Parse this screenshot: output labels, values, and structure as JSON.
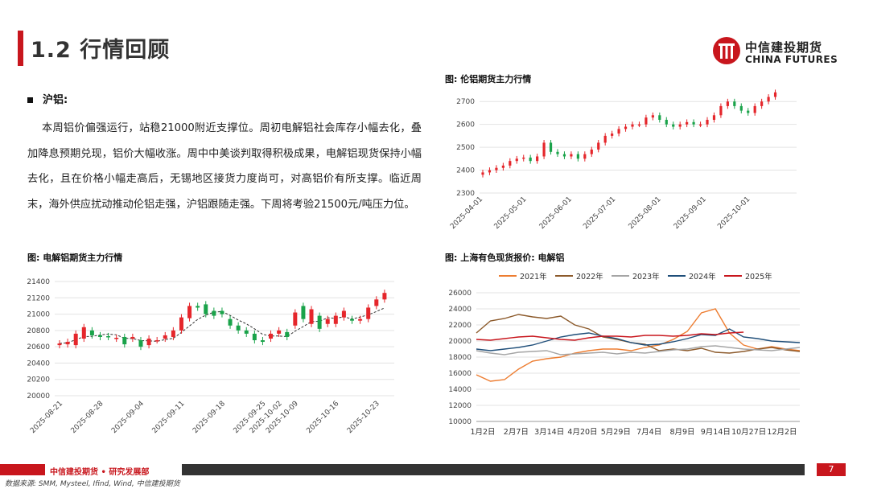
{
  "header": {
    "title": "1.2 行情回顾",
    "logo_cn": "中信建投期货",
    "logo_en": "CHINA FUTURES"
  },
  "section": {
    "heading": "沪铝:",
    "body": "本周铝价偏强运行，站稳21000附近支撑位。周初电解铝社会库存小幅去化，叠加降息预期兑现，铝价大幅收涨。周中中美谈判取得积极成果，电解铝现货保持小幅去化，且在价格小幅走高后，无锡地区接货力度尚可，对高铝价有所支撑。临近周末，海外供应扰动推动伦铝走强，沪铝跟随走强。下周将考验21500元/吨压力位。"
  },
  "footer": {
    "brand": "中信建投期货 • 研究发展部",
    "page": "7",
    "source": "数据来源: SMM, Mysteel, Ifind, Wind, 中信建投期货"
  },
  "colors": {
    "accent_red": "#c8161d",
    "candle_up": "#e5262b",
    "candle_down": "#1aa34a"
  },
  "chart_data": [
    {
      "type": "candlestick",
      "title": "图: 伦铝期货主力行情",
      "ylim": [
        2300,
        2750
      ],
      "y_ticks": [
        2300,
        2400,
        2500,
        2600,
        2700
      ],
      "x_ticks": [
        "2025-04-01",
        "2025-05-01",
        "2025-06-01",
        "2025-07-01",
        "2025-08-01",
        "2025-09-01",
        "2025-10-01"
      ],
      "x_range": [
        "2025-04-01",
        "2025-10-24"
      ],
      "grid": true,
      "close": [
        2390,
        2400,
        2410,
        2420,
        2440,
        2450,
        2455,
        2440,
        2460,
        2520,
        2480,
        2470,
        2460,
        2470,
        2450,
        2470,
        2490,
        2520,
        2550,
        2560,
        2580,
        2590,
        2600,
        2600,
        2630,
        2640,
        2620,
        2600,
        2590,
        2600,
        2610,
        2600,
        2600,
        2620,
        2640,
        2680,
        2700,
        2680,
        2660,
        2650,
        2680,
        2700,
        2720,
        2740
      ]
    },
    {
      "type": "candlestick",
      "title": "图: 电解铝期货主力行情",
      "ylim": [
        20000,
        21400
      ],
      "y_ticks": [
        20000,
        20200,
        20400,
        20600,
        20800,
        21000,
        21200,
        21400
      ],
      "x_ticks": [
        "2025-08-21",
        "2025-08-28",
        "2025-09-04",
        "2025-09-11",
        "2025-09-18",
        "2025-09-25",
        "2025-10-02",
        "2025-10-09",
        "2025-10-16",
        "2025-10-23"
      ],
      "ma_line": true,
      "grid": true,
      "candles": [
        {
          "date": "2025-08-21",
          "o": 20620,
          "c": 20640
        },
        {
          "date": "2025-08-22",
          "o": 20630,
          "c": 20660
        },
        {
          "date": "2025-08-25",
          "o": 20620,
          "c": 20760
        },
        {
          "date": "2025-08-26",
          "o": 20700,
          "c": 20840
        },
        {
          "date": "2025-08-27",
          "o": 20800,
          "c": 20740
        },
        {
          "date": "2025-08-28",
          "o": 20740,
          "c": 20720
        },
        {
          "date": "2025-08-29",
          "o": 20730,
          "c": 20720
        },
        {
          "date": "2025-09-01",
          "o": 20700,
          "c": 20710
        },
        {
          "date": "2025-09-02",
          "o": 20720,
          "c": 20630
        },
        {
          "date": "2025-09-03",
          "o": 20700,
          "c": 20720
        },
        {
          "date": "2025-09-04",
          "o": 20680,
          "c": 20600
        },
        {
          "date": "2025-09-05",
          "o": 20620,
          "c": 20700
        },
        {
          "date": "2025-09-08",
          "o": 20680,
          "c": 20680
        },
        {
          "date": "2025-09-09",
          "o": 20700,
          "c": 20740
        },
        {
          "date": "2025-09-10",
          "o": 20720,
          "c": 20800
        },
        {
          "date": "2025-09-11",
          "o": 20800,
          "c": 20960
        },
        {
          "date": "2025-09-12",
          "o": 20950,
          "c": 21100
        },
        {
          "date": "2025-09-15",
          "o": 21100,
          "c": 21080
        },
        {
          "date": "2025-09-16",
          "o": 21120,
          "c": 21000
        },
        {
          "date": "2025-09-17",
          "o": 21040,
          "c": 20980
        },
        {
          "date": "2025-09-18",
          "o": 21040,
          "c": 21000
        },
        {
          "date": "2025-09-19",
          "o": 20940,
          "c": 20860
        },
        {
          "date": "2025-09-22",
          "o": 20860,
          "c": 20800
        },
        {
          "date": "2025-09-23",
          "o": 20800,
          "c": 20760
        },
        {
          "date": "2025-09-24",
          "o": 20760,
          "c": 20680
        },
        {
          "date": "2025-09-25",
          "o": 20680,
          "c": 20660
        },
        {
          "date": "2025-09-26",
          "o": 20700,
          "c": 20760
        },
        {
          "date": "2025-09-29",
          "o": 20760,
          "c": 20800
        },
        {
          "date": "2025-09-30",
          "o": 20780,
          "c": 20720
        },
        {
          "date": "2025-10-09",
          "o": 20860,
          "c": 21020
        },
        {
          "date": "2025-10-10",
          "o": 21100,
          "c": 20940
        },
        {
          "date": "2025-10-13",
          "o": 20880,
          "c": 21060
        },
        {
          "date": "2025-10-14",
          "o": 20980,
          "c": 20820
        },
        {
          "date": "2025-10-15",
          "o": 20880,
          "c": 20940
        },
        {
          "date": "2025-10-16",
          "o": 20880,
          "c": 20980
        },
        {
          "date": "2025-10-17",
          "o": 20960,
          "c": 21040
        },
        {
          "date": "2025-10-20",
          "o": 20940,
          "c": 20920
        },
        {
          "date": "2025-10-21",
          "o": 20920,
          "c": 20940
        },
        {
          "date": "2025-10-22",
          "o": 20940,
          "c": 21080
        },
        {
          "date": "2025-10-23",
          "o": 21100,
          "c": 21180
        },
        {
          "date": "2025-10-24",
          "o": 21180,
          "c": 21260
        }
      ]
    },
    {
      "type": "line",
      "title": "图: 上海有色现货报价: 电解铝",
      "ylim": [
        10000,
        26000
      ],
      "y_ticks": [
        10000,
        12000,
        14000,
        16000,
        18000,
        20000,
        22000,
        24000,
        26000
      ],
      "x_ticks": [
        "1月2日",
        "2月7日",
        "3月14日",
        "4月20日",
        "5月29日",
        "7月4日",
        "8月9日",
        "9月14日",
        "10月27日",
        "12月2日"
      ],
      "legend_position": "top",
      "grid": true,
      "series": [
        {
          "name": "2021年",
          "color": "#ed7d31",
          "values": [
            15800,
            15000,
            15200,
            16500,
            17500,
            17800,
            18000,
            18500,
            18800,
            19000,
            19000,
            18800,
            19200,
            19500,
            20200,
            21200,
            23500,
            24000,
            21000,
            19500,
            19000,
            19300,
            19000,
            18800
          ]
        },
        {
          "name": "2022年",
          "color": "#8c5a2b",
          "values": [
            21000,
            22500,
            22800,
            23300,
            23000,
            22800,
            23100,
            22000,
            21500,
            20500,
            20200,
            19800,
            19600,
            18800,
            19000,
            18800,
            19100,
            18600,
            18500,
            18700,
            19000,
            19200,
            18900,
            18700
          ]
        },
        {
          "name": "2023年",
          "color": "#a5a5a5",
          "values": [
            18800,
            18500,
            18300,
            18600,
            18700,
            18800,
            18300,
            18400,
            18500,
            18600,
            18400,
            18600,
            18500,
            18700,
            18900,
            19000,
            19300,
            19400,
            19200,
            19000,
            18900,
            18800,
            19000,
            19200
          ]
        },
        {
          "name": "2024年",
          "color": "#1f4e79",
          "values": [
            19000,
            18800,
            19000,
            19200,
            19500,
            20000,
            20500,
            20800,
            21000,
            20600,
            20300,
            19800,
            19500,
            19600,
            19900,
            20300,
            20800,
            20700,
            21500,
            20500,
            20300,
            20000,
            19900,
            19800
          ]
        },
        {
          "name": "2025年",
          "color": "#c8161d",
          "values": [
            20200,
            20100,
            20300,
            20500,
            20600,
            20400,
            20200,
            20100,
            20400,
            20600,
            20600,
            20500,
            20700,
            20700,
            20600,
            20700,
            20900,
            20800,
            21000,
            21100
          ]
        }
      ]
    }
  ]
}
